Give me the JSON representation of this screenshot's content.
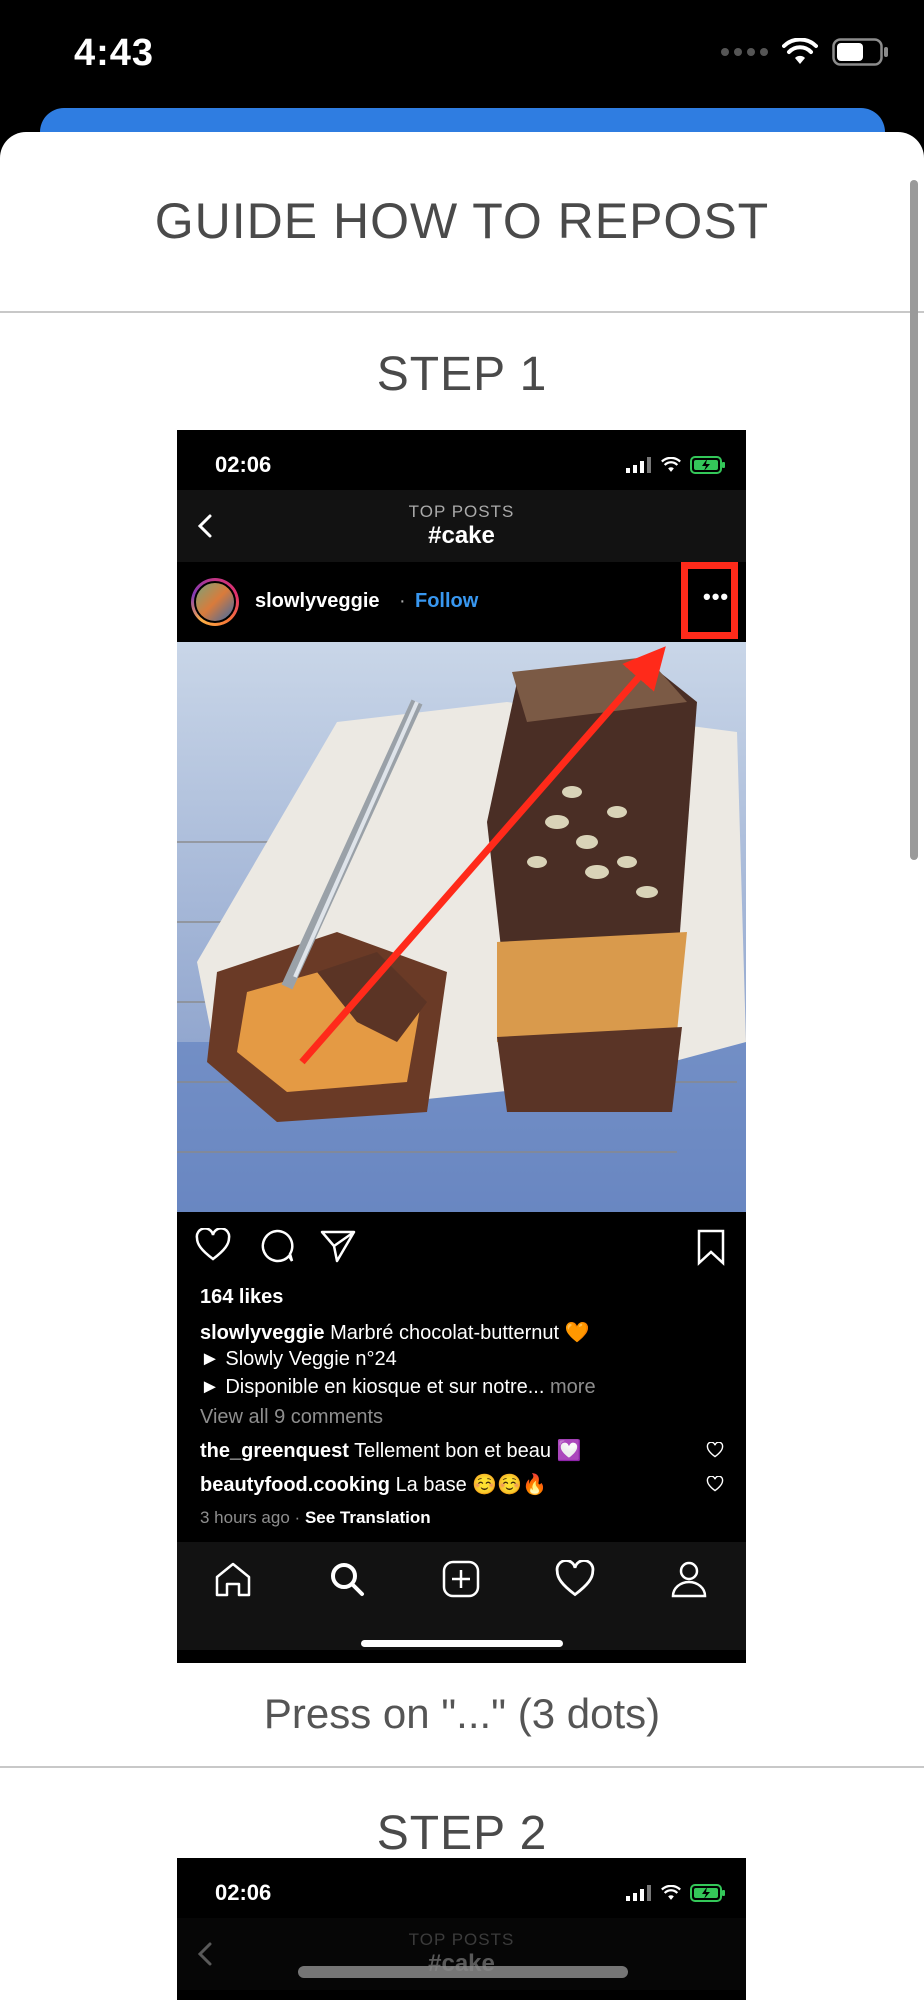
{
  "status_bar": {
    "time": "4:43"
  },
  "sheet": {
    "title": "GUIDE HOW TO REPOST",
    "steps": [
      {
        "title": "STEP 1",
        "caption": "Press on \"...\" (3 dots)"
      },
      {
        "title": "STEP 2"
      }
    ]
  },
  "screenshot": {
    "time": "02:06",
    "nav_subtitle": "TOP POSTS",
    "nav_title": "#cake",
    "post": {
      "username": "slowlyveggie",
      "separator": "·",
      "follow_label": "Follow",
      "more_label": "•••",
      "likes": "164 likes",
      "caption_username": "slowlyveggie",
      "caption_text": "Marbré chocolat-butternut 🧡",
      "caption_line2": "► Slowly Veggie n°24",
      "caption_line3": "► Disponible en kiosque et sur notre...",
      "caption_more": "more",
      "view_comments": "View all 9 comments",
      "comments": [
        {
          "user": "the_greenquest",
          "text": "Tellement bon et beau 💟"
        },
        {
          "user": "beautyfood.cooking",
          "text": "La base ☺️☺️🔥"
        }
      ],
      "time_ago": "3 hours ago",
      "see_translation": "See Translation"
    }
  },
  "colors": {
    "accent_blue": "#2f7de1",
    "follow_blue": "#3897f0",
    "highlight_red": "#ff2a1a"
  }
}
